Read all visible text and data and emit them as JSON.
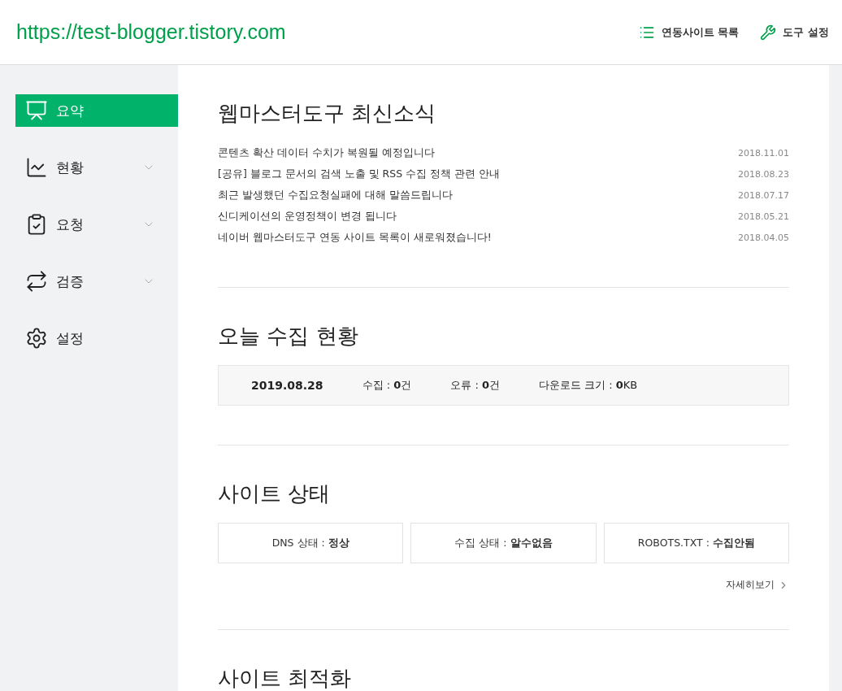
{
  "header": {
    "site_url": "https://test-blogger.tistory.com",
    "actions": [
      {
        "kind": "list",
        "label": "연동사이트 목록"
      },
      {
        "kind": "wrench",
        "label": "도구 설정"
      }
    ]
  },
  "sidebar": {
    "items": [
      {
        "kind": "summary",
        "label": "요약",
        "selected": true,
        "expandable": false
      },
      {
        "kind": "chart",
        "label": "현황",
        "selected": false,
        "expandable": true
      },
      {
        "kind": "request",
        "label": "요청",
        "selected": false,
        "expandable": true
      },
      {
        "kind": "verify",
        "label": "검증",
        "selected": false,
        "expandable": true
      },
      {
        "kind": "settings",
        "label": "설정",
        "selected": false,
        "expandable": false
      }
    ]
  },
  "news": {
    "title": "웹마스터도구 최신소식",
    "items": [
      {
        "title": "콘텐츠 확산 데이터 수치가 복원될 예정입니다",
        "date": "2018.11.01"
      },
      {
        "title": "[공유] 블로그 문서의 검색 노출 및 RSS 수집 정책 관련 안내",
        "date": "2018.08.23"
      },
      {
        "title": "최근 발생했던 수집요청실패에 대해 말씀드립니다",
        "date": "2018.07.17"
      },
      {
        "title": "신디케이션의 운영정책이 변경 됩니다",
        "date": "2018.05.21"
      },
      {
        "title": "네이버 웹마스터도구 연동 사이트 목록이 새로워졌습니다!",
        "date": "2018.04.05"
      }
    ]
  },
  "today": {
    "title": "오늘 수집 현황",
    "date": "2019.08.28",
    "stats": [
      "수집 : **0**건",
      "오류 : **0**건",
      "다운로드 크기 : **0**KB"
    ]
  },
  "site_status": {
    "title": "사이트 상태",
    "cards": [
      "DNS 상태 : **정상**",
      "수집 상태 : **알수없음**",
      "ROBOTS.TXT : **수집안됨**"
    ],
    "more_link": "자세히보기"
  },
  "optimization": {
    "title": "사이트 최적화"
  }
}
